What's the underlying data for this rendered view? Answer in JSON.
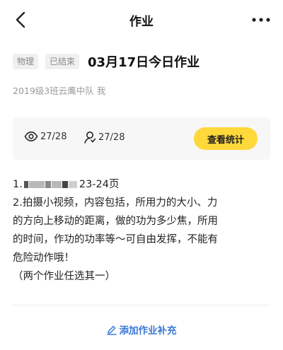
{
  "nav": {
    "title": "作业"
  },
  "header": {
    "tags": [
      "物理",
      "已结束"
    ],
    "title": "03月17日今日作业",
    "class_info": "2019级3班云鹰中队  我"
  },
  "stats": {
    "views": "27/28",
    "people": "27/28",
    "button_label": "查看统计"
  },
  "content": {
    "line1_prefix": "1.",
    "line1_suffix": "23-24页",
    "lines": [
      "2.拍摄小视频，内容包括，所用力的大小、力",
      "的方向上移动的距离，做的功为多少焦，所用",
      "的时间，作功的功率等～可自由发挥，不能有",
      "危险动作哦！",
      "（两个作业任选其一）"
    ]
  },
  "footer": {
    "add_label": "添加作业补充"
  },
  "colors": {
    "accent_yellow": "#ffd83a",
    "link_blue": "#3a78d8"
  }
}
